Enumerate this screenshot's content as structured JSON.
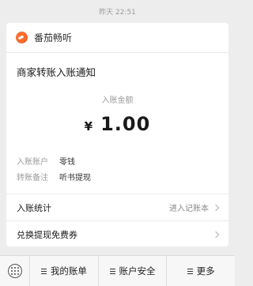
{
  "timestamp": "昨天 22:51",
  "card": {
    "app_name": "番茄畅听",
    "title": "商家转账入账通知",
    "amount_label": "入账金额",
    "currency": "¥",
    "amount": "1.00",
    "info": [
      {
        "key": "入账账户",
        "value": "零钱"
      },
      {
        "key": "转账备注",
        "value": "听书提现"
      }
    ],
    "rows": [
      {
        "label": "入账统计",
        "action": "进入记账本"
      },
      {
        "label": "兑换提现免费券",
        "action": ""
      }
    ]
  },
  "bottom_menu": [
    {
      "label": "我的账单"
    },
    {
      "label": "账户安全"
    },
    {
      "label": "更多"
    }
  ],
  "colors": {
    "logo": "#f05a1a",
    "background": "#ededed"
  }
}
